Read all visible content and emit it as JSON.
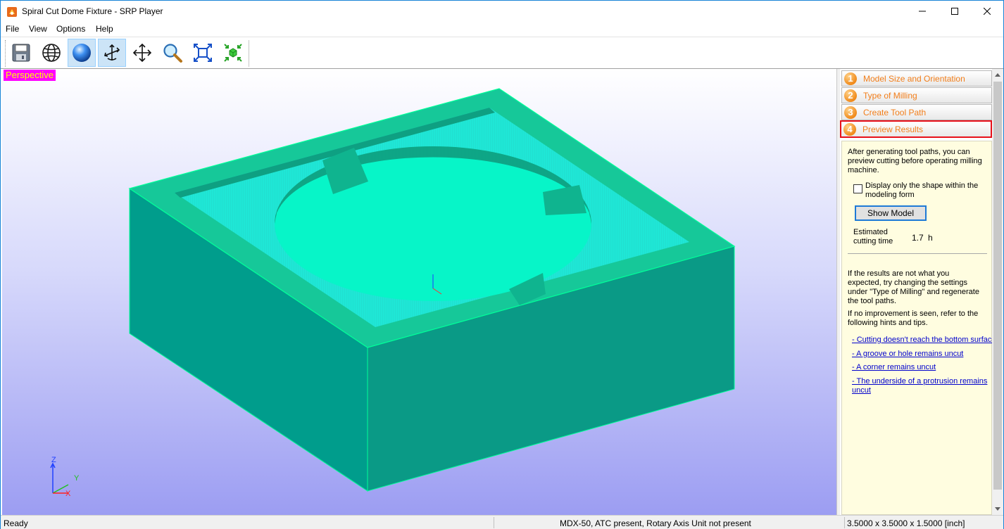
{
  "window": {
    "title": "Spiral Cut Dome Fixture - SRP Player"
  },
  "menu": [
    "File",
    "View",
    "Options",
    "Help"
  ],
  "toolbar": {
    "buttons": [
      "save-icon",
      "globe-icon",
      "sphere-shading-icon",
      "rotate-icon",
      "pan-icon",
      "zoom-icon",
      "fit-view-icon",
      "fit-model-icon"
    ],
    "active": [
      "sphere-shading-icon",
      "rotate-icon"
    ]
  },
  "viewport": {
    "label": "Perspective",
    "axis": {
      "z": "Z",
      "y": "Y",
      "x": "X"
    },
    "colors": {
      "top": "#1ff5d0",
      "side": "#009b8a",
      "rim": "#16cc9a",
      "border": "#00ff99"
    }
  },
  "steps": [
    {
      "num": "1",
      "label": "Model Size and Orientation"
    },
    {
      "num": "2",
      "label": "Type of Milling"
    },
    {
      "num": "3",
      "label": "Create Tool Path"
    },
    {
      "num": "4",
      "label": "Preview Results"
    }
  ],
  "panel": {
    "intro_lines": [
      "After generating tool paths, you can",
      "preview cutting before operating milling",
      "machine."
    ],
    "checkbox_lines": [
      "Display only the shape within the",
      "modeling form"
    ],
    "show_model_button": "Show Model",
    "estimated_label_lines": [
      "Estimated",
      "cutting time"
    ],
    "estimated_value": "1.7",
    "estimated_unit": "h",
    "results_lines": [
      "If the results are not what you",
      "expected, try changing the settings",
      "under \"Type of Milling\" and regenerate",
      "the tool paths."
    ],
    "improvement_lines": [
      "If no improvement is seen, refer to the",
      "following hints and tips."
    ],
    "links": [
      {
        "lines": [
          "- Cutting doesn't reach the bottom surface"
        ]
      },
      {
        "lines": [
          "- A groove or hole remains uncut"
        ]
      },
      {
        "lines": [
          "- A corner remains uncut"
        ]
      },
      {
        "lines": [
          "- The underside of a protrusion remains",
          "uncut"
        ]
      }
    ]
  },
  "status": {
    "left": "Ready",
    "middle": "MDX-50, ATC present, Rotary Axis Unit not present",
    "right": "3.5000 x 3.5000 x 1.5000 [inch]"
  }
}
